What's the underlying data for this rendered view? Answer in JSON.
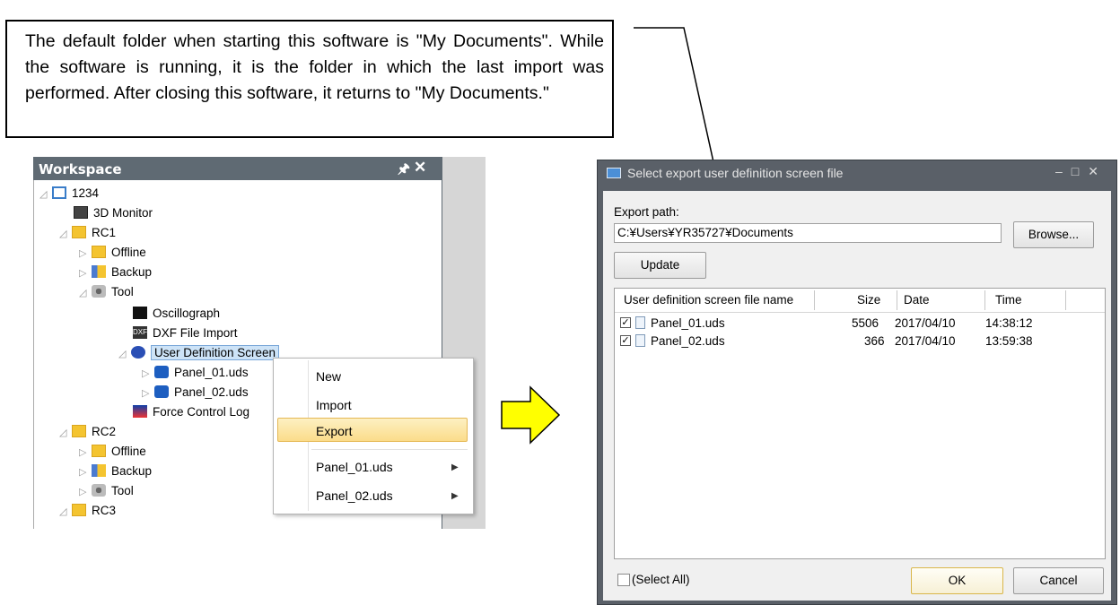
{
  "callout": {
    "text": "The default folder when starting this software is \"My Documents\". While the software is running, it is the folder in which the last import was performed. After closing this software, it returns to \"My Documents.\""
  },
  "workspace": {
    "title": "Workspace",
    "pin_icon": "pin-icon",
    "close_icon": "close-icon",
    "tree": [
      {
        "label": "1234",
        "icon": "project-icon"
      },
      {
        "label": "3D Monitor",
        "icon": "3d-monitor-icon"
      },
      {
        "label": "RC1",
        "icon": "controller-icon"
      },
      {
        "label": "Offline",
        "icon": "folder-icon"
      },
      {
        "label": "Backup",
        "icon": "backup-icon"
      },
      {
        "label": "Tool",
        "icon": "tool-icon"
      },
      {
        "label": "Oscillograph",
        "icon": "oscillograph-icon"
      },
      {
        "label": "DXF File Import",
        "icon": "dxf-icon"
      },
      {
        "label": "User Definition Screen",
        "icon": "user-definition-icon"
      },
      {
        "label": "Panel_01.uds",
        "icon": "panel-icon"
      },
      {
        "label": "Panel_02.uds",
        "icon": "panel-icon"
      },
      {
        "label": "Force Control Log",
        "icon": "force-control-icon"
      },
      {
        "label": "RC2",
        "icon": "controller-icon"
      },
      {
        "label": "Offline",
        "icon": "folder-icon"
      },
      {
        "label": "Backup",
        "icon": "backup-icon"
      },
      {
        "label": "Tool",
        "icon": "tool-icon"
      },
      {
        "label": "RC3",
        "icon": "controller-icon"
      }
    ]
  },
  "context_menu": {
    "items": [
      "New",
      "Import",
      "Export",
      "Panel_01.uds",
      "Panel_02.uds"
    ],
    "highlighted": "Export"
  },
  "dialog": {
    "title": "Select export user definition screen file",
    "export_path_label": "Export path:",
    "export_path_value": "C:¥Users¥YR35727¥Documents",
    "browse_label": "Browse...",
    "update_label": "Update",
    "columns": [
      "User definition screen file name",
      "Size",
      "Date",
      "Time"
    ],
    "rows": [
      {
        "checked": true,
        "name": "Panel_01.uds",
        "size": "5506",
        "date": "2017/04/10",
        "time": "14:38:12"
      },
      {
        "checked": true,
        "name": "Panel_02.uds",
        "size": "366",
        "date": "2017/04/10",
        "time": "13:59:38"
      }
    ],
    "select_all_label": "(Select All)",
    "ok_label": "OK",
    "cancel_label": "Cancel"
  },
  "colors": {
    "workspace_header": "#5f6a73",
    "dialog_frame": "#5a6068",
    "highlight": "#fbdc8a",
    "arrow_fill": "#ffff00"
  }
}
